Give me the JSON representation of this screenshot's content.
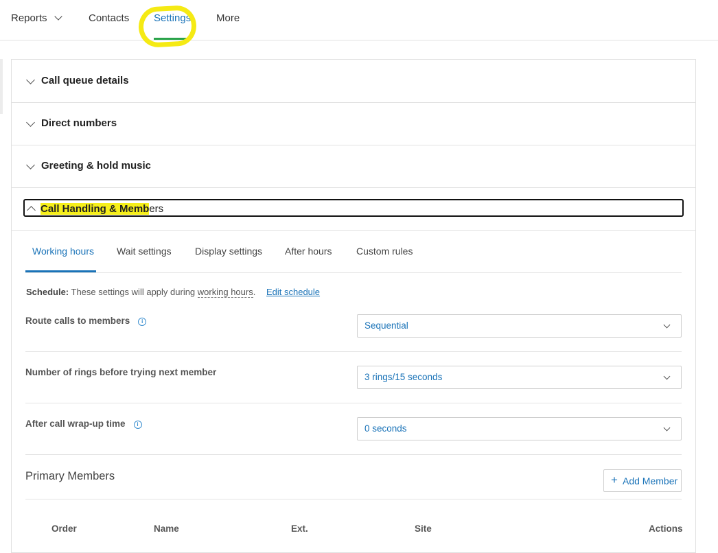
{
  "topnav": {
    "items": [
      {
        "label": "Reports"
      },
      {
        "label": "Contacts"
      },
      {
        "label": "Settings"
      },
      {
        "label": "More"
      }
    ]
  },
  "sections": [
    {
      "title": "Call queue details"
    },
    {
      "title": "Direct numbers"
    },
    {
      "title": "Greeting & hold music"
    },
    {
      "title_highlighted": "Call Handling & Memb",
      "title_rest": "ers"
    }
  ],
  "tabs": [
    "Working hours",
    "Wait settings",
    "Display settings",
    "After hours",
    "Custom rules"
  ],
  "schedule": {
    "label": "Schedule:",
    "text_before": "These settings will apply during",
    "underlined": "working hours",
    "text_after": ".",
    "link": "Edit schedule"
  },
  "settings": [
    {
      "label": "Route calls to members",
      "value": "Sequential",
      "info_icon": "info-icon"
    },
    {
      "label": "Number of rings before trying next member",
      "value": "3 rings/15 seconds"
    },
    {
      "label": "After call wrap-up time",
      "value": "0 seconds",
      "info_icon": "info-icon"
    }
  ],
  "primary_members": {
    "title": "Primary Members",
    "add_button": "Add Member",
    "columns": [
      "Order",
      "Name",
      "Ext.",
      "Site",
      "Actions"
    ]
  },
  "colors": {
    "accent": "#1a73b8",
    "highlight": "#f6ef1a",
    "active_underline": "#2aa34a"
  }
}
